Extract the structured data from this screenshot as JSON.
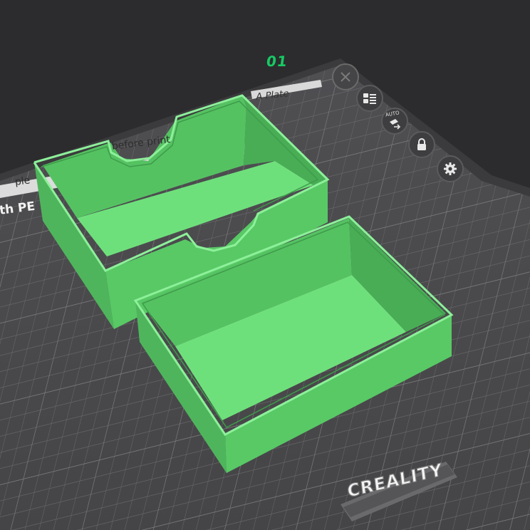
{
  "plate": {
    "number": "01",
    "name": "A Plate"
  },
  "notices": {
    "line1": "ple",
    "line2": "before print",
    "line3": "th PE"
  },
  "toolbar": {
    "close_icon": "close-icon",
    "arrange_icon": "list-layout-icon",
    "auto_label": "AUTO",
    "lock_icon": "lock-icon",
    "settings_icon": "gear-icon"
  },
  "brand": {
    "logo_text": "CREALITY"
  },
  "colors": {
    "model_green": "#5cd66a",
    "plate_dark": "#4a4a4c",
    "background": "#2c2c2e",
    "plate_number_green": "#17c964"
  }
}
